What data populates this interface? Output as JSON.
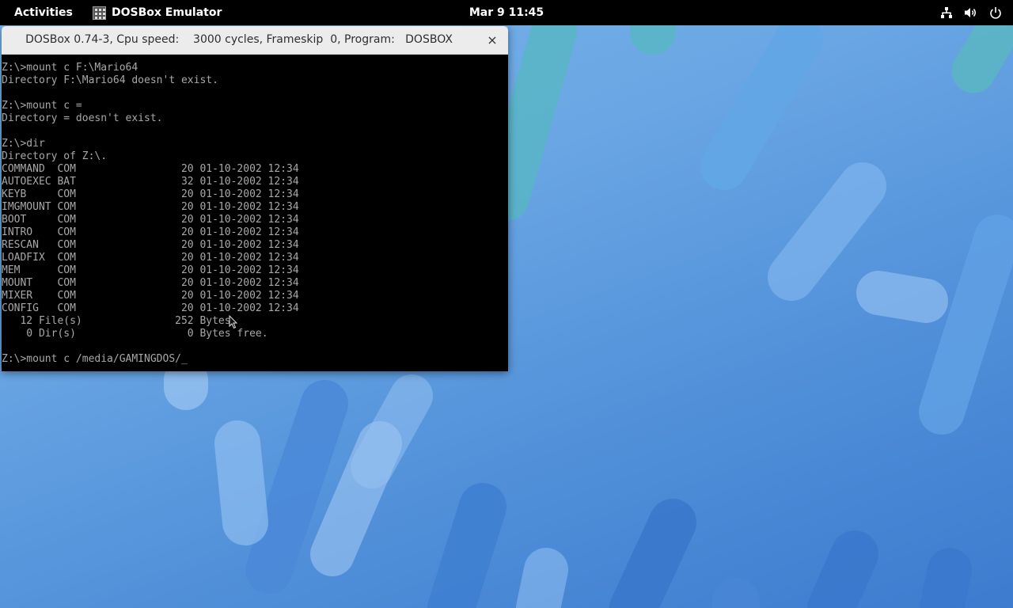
{
  "topbar": {
    "activities_label": "Activities",
    "app_name": "DOSBox Emulator",
    "clock": "Mar 9  11:45",
    "icons": [
      "network-icon",
      "volume-icon",
      "power-icon"
    ]
  },
  "window": {
    "title": "DOSBox 0.74-3, Cpu speed:    3000 cycles, Frameskip  0, Program:   DOSBOX",
    "close_glyph": "×"
  },
  "console": {
    "lines": [
      "Z:\\>mount c F:\\Mario64",
      "Directory F:\\Mario64 doesn't exist.",
      "",
      "Z:\\>mount c =",
      "Directory = doesn't exist.",
      "",
      "Z:\\>dir",
      "Directory of Z:\\.",
      "COMMAND  COM                 20 01-10-2002 12:34",
      "AUTOEXEC BAT                 32 01-10-2002 12:34",
      "KEYB     COM                 20 01-10-2002 12:34",
      "IMGMOUNT COM                 20 01-10-2002 12:34",
      "BOOT     COM                 20 01-10-2002 12:34",
      "INTRO    COM                 20 01-10-2002 12:34",
      "RESCAN   COM                 20 01-10-2002 12:34",
      "LOADFIX  COM                 20 01-10-2002 12:34",
      "MEM      COM                 20 01-10-2002 12:34",
      "MOUNT    COM                 20 01-10-2002 12:34",
      "MIXER    COM                 20 01-10-2002 12:34",
      "CONFIG   COM                 20 01-10-2002 12:34",
      "   12 File(s)               252 Bytes.",
      "    0 Dir(s)                  0 Bytes free.",
      ""
    ],
    "current_input": "Z:\\>mount c /media/GAMINGDOS/",
    "cursor": "_"
  },
  "colors": {
    "topbar_bg": "#000000",
    "console_bg": "#000000",
    "console_text": "#a8a8a8",
    "titlebar_bg": "#ececec"
  }
}
